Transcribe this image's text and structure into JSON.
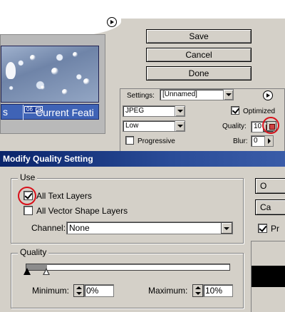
{
  "top_panel": {
    "buttons": {
      "save": "Save",
      "cancel": "Cancel",
      "done": "Done"
    },
    "preview": {
      "slice_left_text": "s",
      "slice_number": "06",
      "slice_title": "Current Feati"
    },
    "settings": {
      "label": "Settings:",
      "preset_value": "[Unnamed]",
      "format_value": "JPEG",
      "quality_preset_value": "Low",
      "optimized_label": "Optimized",
      "optimized_checked": true,
      "quality_label": "Quality:",
      "quality_value": "10",
      "progressive_label": "Progressive",
      "progressive_checked": false,
      "blur_label": "Blur:",
      "blur_value": "0"
    }
  },
  "dialog": {
    "title": "Modify Quality Setting",
    "use_group": {
      "title": "Use",
      "all_text_layers_label": "All Text Layers",
      "all_text_layers_checked": true,
      "all_vector_shape_layers_label": "All Vector Shape Layers",
      "all_vector_shape_layers_checked": false,
      "channel_label": "Channel:",
      "channel_value": "None"
    },
    "quality_group": {
      "title": "Quality",
      "minimum_label": "Minimum:",
      "minimum_value": "0%",
      "maximum_label": "Maximum:",
      "maximum_value": "10%",
      "slider_min_fraction": 0.0,
      "slider_max_fraction": 0.1
    },
    "side": {
      "button1_label": "O",
      "button2_label": "Ca",
      "preview_check_label": "Pr",
      "preview_checked": true
    }
  },
  "colors": {
    "highlight_ring": "#d8101a",
    "titlebar": "#0a246a",
    "dialog_bg": "#d4d0c8"
  }
}
